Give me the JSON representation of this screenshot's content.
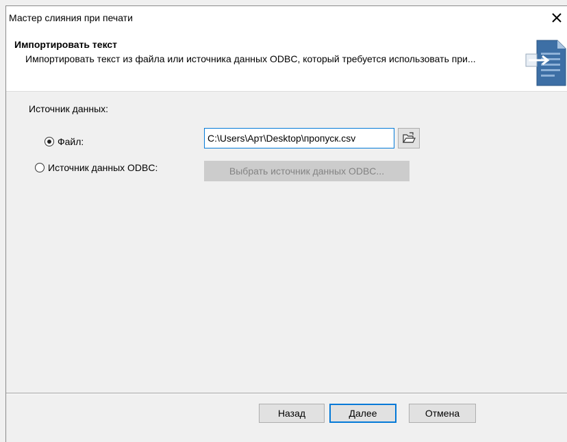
{
  "window": {
    "title": "Мастер слияния при печати"
  },
  "header": {
    "title": "Импортировать текст",
    "description": "Импортировать текст из файла или источника данных ODBC, который требуется использовать при..."
  },
  "source": {
    "label": "Источник данных:",
    "file_option": {
      "label": "Файл:",
      "selected": true,
      "path": "C:\\Users\\Арт\\Desktop\\пропуск.csv"
    },
    "odbc_option": {
      "label": "Источник данных ODBC:",
      "selected": false,
      "button_label": "Выбрать источник данных ODBC..."
    }
  },
  "footer": {
    "back_label": "Назад",
    "next_label": "Далее",
    "cancel_label": "Отмена"
  },
  "colors": {
    "accent": "#0078d7",
    "disabled_text": "#838383"
  },
  "icons": {
    "close": "close-icon",
    "browse": "folder-open-icon",
    "header": "import-document-icon"
  }
}
